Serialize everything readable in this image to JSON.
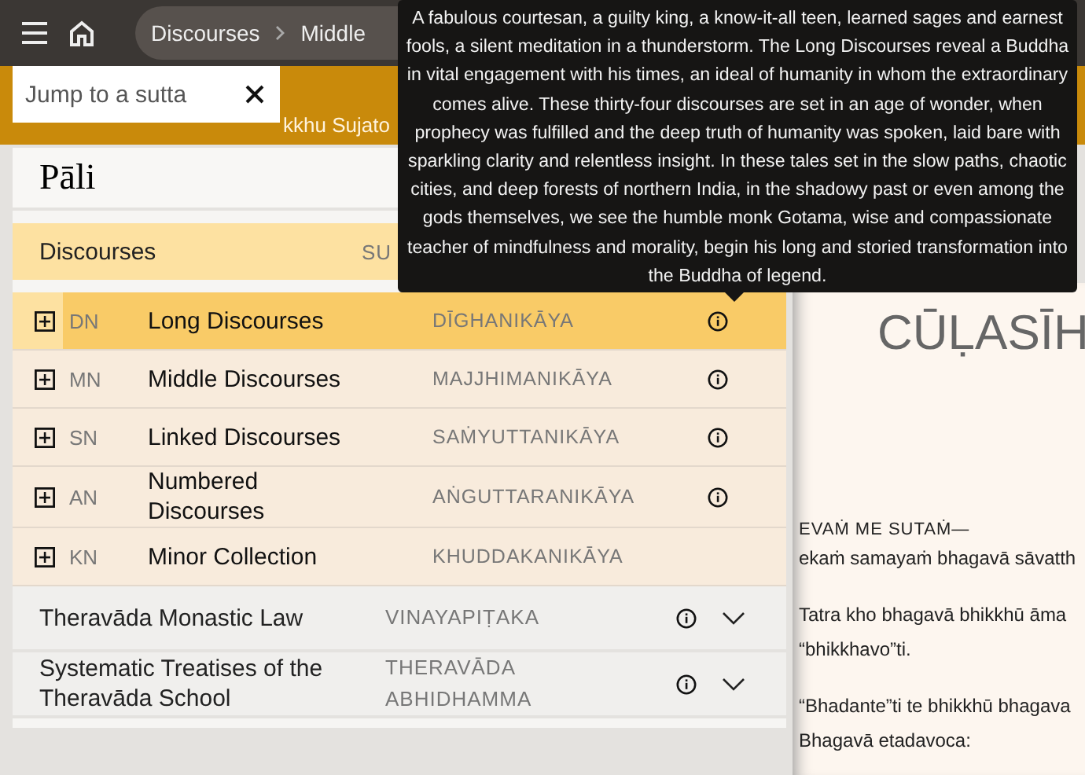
{
  "topbar": {
    "breadcrumb": [
      {
        "label": "Discourses"
      },
      {
        "label": "Middle"
      }
    ]
  },
  "banner": {
    "text": "kkhu Sujato"
  },
  "search": {
    "placeholder": "Jump to a sutta"
  },
  "panel": {
    "title": "Pāli",
    "sections": [
      {
        "label": "Discourses",
        "pali": "SU",
        "expanded": true,
        "children": [
          {
            "code": "DN",
            "label": "Long Discourses",
            "pali": "DĪGHANIKĀYA",
            "selected": true,
            "info": true
          },
          {
            "code": "MN",
            "label": "Middle Discourses",
            "pali": "MAJJHIMANIKĀYA",
            "selected": false,
            "info": true
          },
          {
            "code": "SN",
            "label": "Linked Discourses",
            "pali": "SAṀYUTTANIKĀYA",
            "selected": false,
            "info": true
          },
          {
            "code": "AN",
            "label": "Numbered Discourses",
            "pali": "AṄGUTTARANIKĀYA",
            "selected": false,
            "info": true
          },
          {
            "code": "KN",
            "label": "Minor Collection",
            "pali": "KHUDDAKANIKĀYA",
            "selected": false,
            "info": false
          }
        ]
      },
      {
        "label": "Theravāda Monastic Law",
        "pali": "VINAYAPIṬAKA",
        "expanded": false
      },
      {
        "label": "Systematic Treatises of the Theravāda School",
        "pali": "THERAVĀDA ABHIDHAMMA",
        "expanded": false
      }
    ]
  },
  "tooltip": {
    "text": "A fabulous courtesan, a guilty king, a know-it-all teen, learned sages and earnest fools, a silent meditation in a thunderstorm. The Long Discourses reveal a Buddha in vital engagement with his times, an ideal of humanity in whom the extraordinary comes alive. These thirty-four discourses are set in an age of wonder, when prophecy was fulfilled and the deep truth of humanity was spoken, laid bare with sparkling clarity and relentless insight. In these tales set in the slow paths, chaotic cities, and deep forests of northern India, in the shadowy past or even among the gods themselves, we see the humble monk Gotama, wise and compassionate teacher of mindfulness and morality, begin his long and storied transformation into the Buddha of legend."
  },
  "reading": {
    "title": "CŪḶASĪH",
    "blocks": [
      {
        "kind": "opening",
        "lines": [
          "EVAṀ ME SUTAṀ—",
          "ekaṁ samayaṁ bhagavā sāvatth"
        ]
      },
      {
        "kind": "paragraph",
        "lines": [
          "Tatra kho bhagavā bhikkhū āma",
          "“bhikkhavo”ti."
        ]
      },
      {
        "kind": "paragraph",
        "lines": [
          "“Bhadante”ti te bhikkhū bhagava",
          "Bhagavā etadavoca:"
        ]
      }
    ]
  }
}
